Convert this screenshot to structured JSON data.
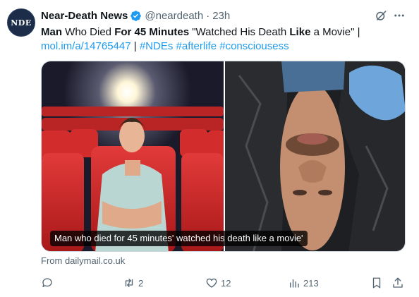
{
  "account": {
    "avatar_text": "NDE",
    "display_name": "Near-Death News",
    "handle": "@neardeath",
    "separator": "·",
    "time": "23h"
  },
  "tweet": {
    "headline_parts": [
      {
        "text": "Man",
        "bold": true
      },
      {
        "text": " Who Died ",
        "bold": false
      },
      {
        "text": "For 45 Minutes",
        "bold": true
      },
      {
        "text": " \"Watched His Death ",
        "bold": false
      },
      {
        "text": "Like",
        "bold": true
      },
      {
        "text": " a Movie\" |",
        "bold": false
      }
    ],
    "link": "mol.im/a/14765447",
    "link_separator": " | ",
    "hashtags": [
      "#NDEs",
      "#afterlife",
      "#consciousess"
    ]
  },
  "media": {
    "caption": "Man who died for 45 minutes' watched his death like a movie'"
  },
  "source": "From dailymail.co.uk",
  "actions": {
    "reply": {
      "icon": "reply-icon",
      "count": ""
    },
    "retweet": {
      "icon": "retweet-icon",
      "count": "2"
    },
    "like": {
      "icon": "heart-icon",
      "count": "12"
    },
    "views": {
      "icon": "views-icon",
      "count": "213"
    },
    "bookmark": {
      "icon": "bookmark-icon"
    },
    "share": {
      "icon": "share-icon"
    }
  },
  "colors": {
    "link": "#1d9bf0",
    "verified": "#1d9bf0",
    "secondary_text": "#536471"
  }
}
